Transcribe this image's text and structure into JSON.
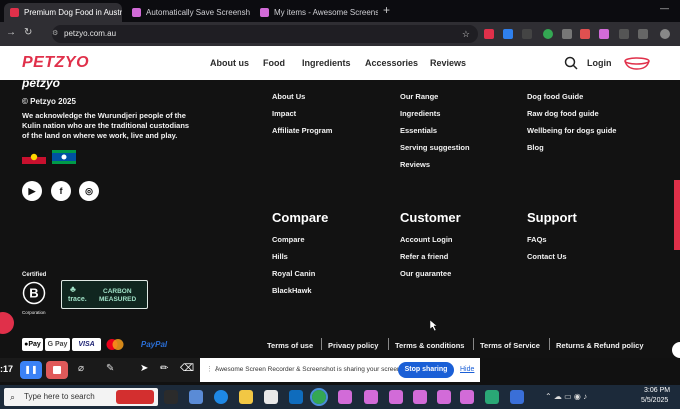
{
  "tabs": [
    {
      "label": "Premium Dog Food in Australia",
      "active": true
    },
    {
      "label": "Automatically Save Screenshot",
      "active": false
    },
    {
      "label": "My items - Awesome Screensh",
      "active": false
    }
  ],
  "browser": {
    "url": "petzyo.com.au",
    "new_tab": "+"
  },
  "header": {
    "logo": "PETZYO",
    "nav": [
      "About us",
      "Food",
      "Ingredients",
      "Accessories",
      "Reviews"
    ],
    "login": "Login"
  },
  "footer": {
    "copyright": "© Petzyo 2025",
    "acknowledgement": [
      "We acknowledge the Wurundjeri people of the",
      "Kulin nation who are the traditional custodians",
      "of the land on where we work, live and play."
    ],
    "col1": [
      "About Us",
      "Impact",
      "Affiliate Program"
    ],
    "col2": [
      "Our Range",
      "Ingredients",
      "Essentials",
      "Serving suggestion",
      "Reviews"
    ],
    "col3": [
      "Dog food Guide",
      "Raw dog food guide",
      "Wellbeing for dogs guide",
      "Blog"
    ],
    "compare": {
      "title": "Compare",
      "items": [
        "Compare",
        "Hills",
        "Royal Canin",
        "BlackHawk"
      ]
    },
    "customer": {
      "title": "Customer",
      "items": [
        "Account Login",
        "Refer a friend",
        "Our guarantee"
      ]
    },
    "support": {
      "title": "Support",
      "items": [
        "FAQs",
        "Contact Us"
      ]
    },
    "certified": "Certified",
    "corporation": "Corporation",
    "trace": "trace.",
    "carbon": "CARBON",
    "measured": "MEASURED",
    "payments": [
      "Pay",
      "G Pay",
      "VISA",
      "",
      "PayPal"
    ],
    "legal": [
      "Terms of use",
      "Privacy policy",
      "Terms & conditions",
      "Terms of Service",
      "Returns & Refund policy"
    ]
  },
  "recorder": {
    "time": ":17"
  },
  "share": {
    "message": "Awesome Screen Recorder & Screenshot is sharing your screen.",
    "stop": "Stop sharing",
    "hide": "Hide"
  },
  "taskbar": {
    "search": "Type here to search",
    "time": "3:06 PM",
    "date": "5/5/2025"
  },
  "colors": {
    "brand": "#e0304a",
    "footer_bg": "#121212",
    "share_blue": "#1a5fd6"
  }
}
